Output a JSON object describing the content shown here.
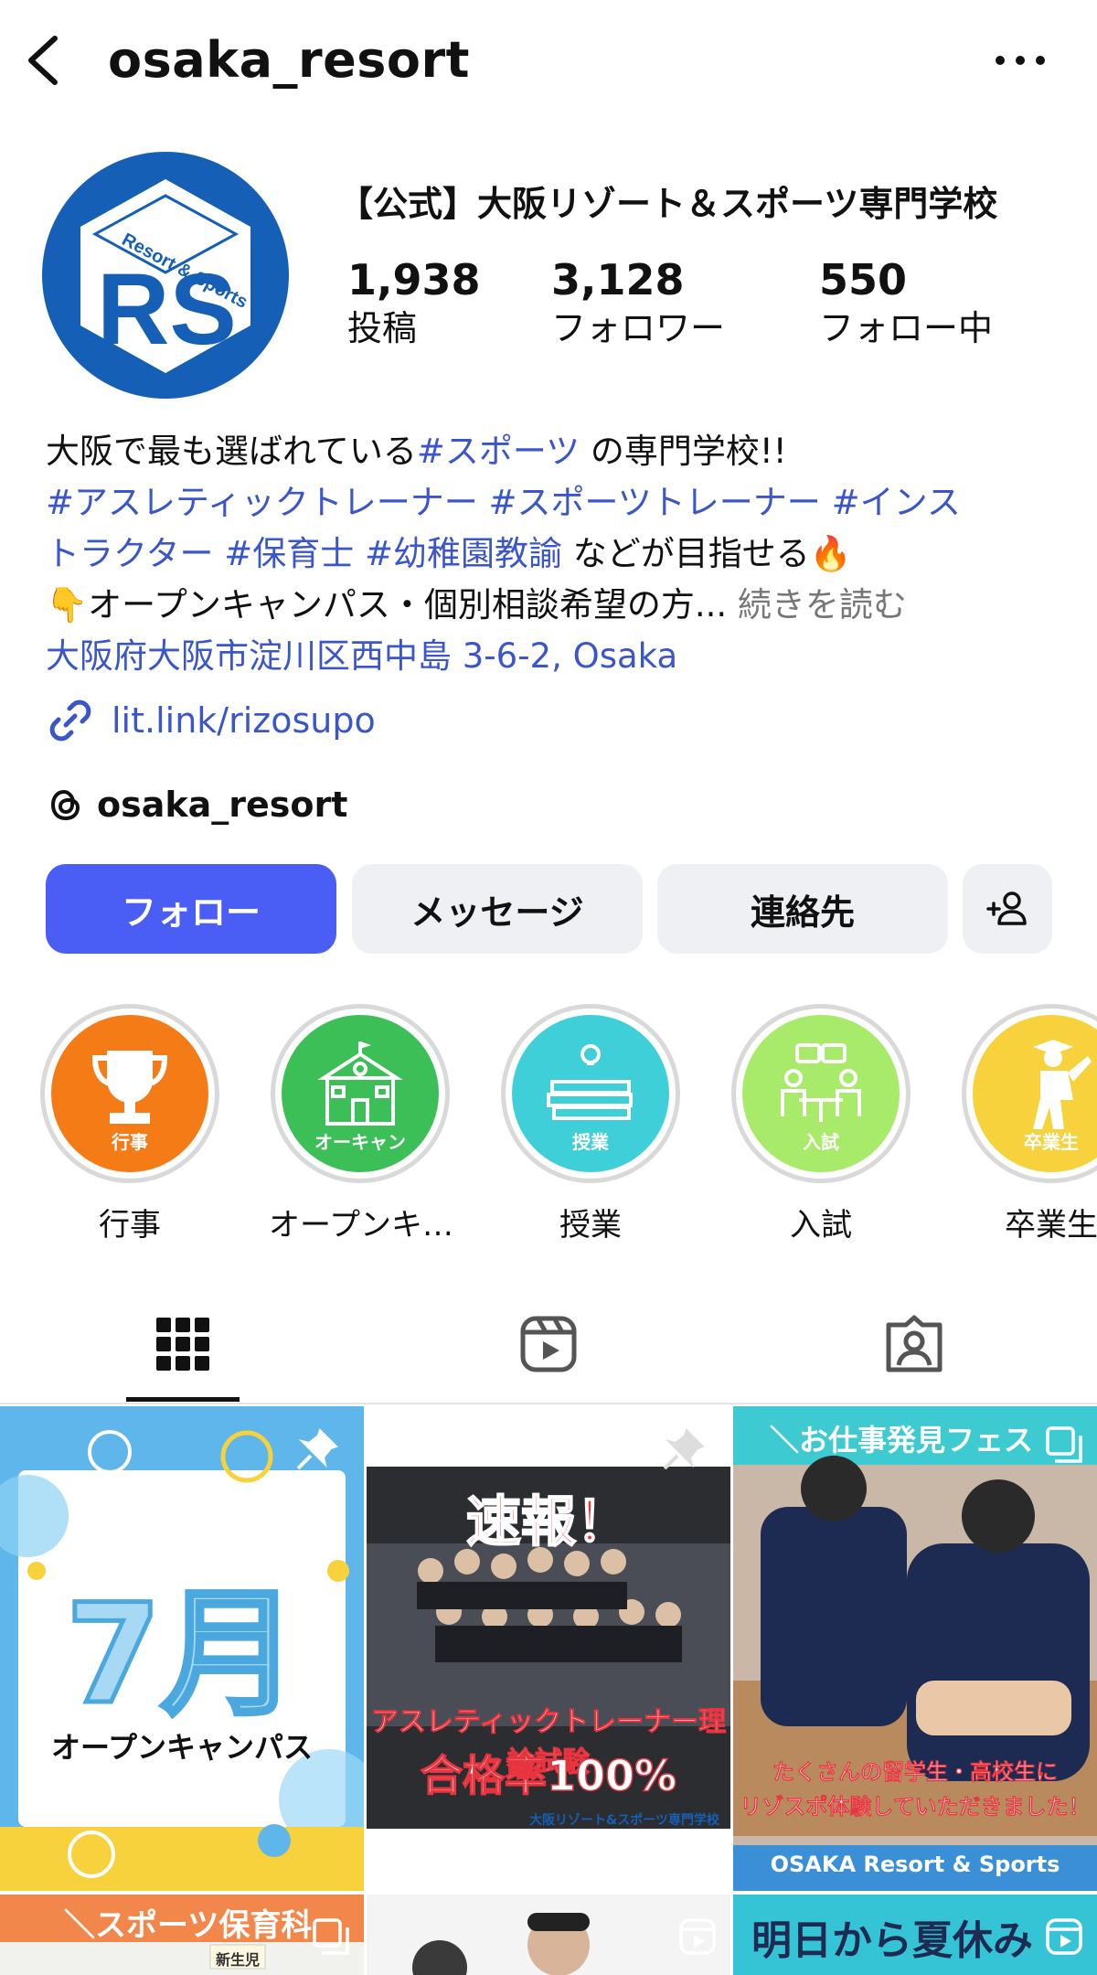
{
  "header": {
    "username": "osaka_resort"
  },
  "profile": {
    "display_name": "【公式】大阪リゾート＆スポーツ専門学校",
    "avatar_letters": "RS",
    "avatar_ring_text": "Resort & Sports",
    "stats": [
      {
        "value": "1,938",
        "label": "投稿"
      },
      {
        "value": "3,128",
        "label": "フォロワー"
      },
      {
        "value": "550",
        "label": "フォロー中"
      }
    ]
  },
  "bio": {
    "line1_prefix": "大阪で最も選ばれている",
    "line1_tag": "#スポーツ",
    "line1_suffix": " の専門学校!!",
    "line2": "#アスレティックトレーナー #スポーツトレーナー #インス",
    "line3_tags": "トラクター #保育士 #幼稚園教諭",
    "line3_suffix": " などが目指せる",
    "line3_emoji": "🔥",
    "line4_emoji": "👇",
    "line4_text": "オープンキャンパス・個別相談希望の方...",
    "line4_more": " 続きを読む",
    "address": "大阪府大阪市淀川区西中島 3-6-2, Osaka",
    "link": "lit.link/rizosupo",
    "threads_handle": "osaka_resort"
  },
  "buttons": {
    "follow": "フォロー",
    "message": "メッセージ",
    "contact": "連絡先"
  },
  "highlights": [
    {
      "label": "行事",
      "inner_text": "行事",
      "color": "#f47b16"
    },
    {
      "label": "オープンキ…",
      "inner_text": "オーキャン",
      "color": "#3cbf57"
    },
    {
      "label": "授業",
      "inner_text": "授業",
      "color": "#3fcfd8"
    },
    {
      "label": "入試",
      "inner_text": "入試",
      "color": "#a8ea6a"
    },
    {
      "label": "卒業生",
      "inner_text": "卒業生",
      "color": "#f7d23c"
    }
  ],
  "tabs": [
    "grid-tab",
    "reels-tab",
    "tagged-tab"
  ],
  "posts": [
    {
      "headline": "7月",
      "subtitle": "オープンキャンパス"
    },
    {
      "headline": "速報！",
      "subtitle": "アスレティックトレーナー理論試験",
      "subtitle2": "合格率100%",
      "footer": "大阪リゾート&スポーツ専門学校"
    },
    {
      "headline": "＼お仕事発見フェス",
      "caption1": "たくさんの留学生・高校生に",
      "caption2": "リゾスポ体験していただきました！",
      "footer": "OSAKA Resort & Sports"
    },
    {
      "headline": "＼スポーツ保育科",
      "tag": "新生児"
    },
    {
      "headline": ""
    },
    {
      "headline": "明日から夏休み"
    }
  ],
  "colors": {
    "accent": "#4a5df5",
    "link": "#3a56c8",
    "brand_blue": "#1560b6"
  }
}
